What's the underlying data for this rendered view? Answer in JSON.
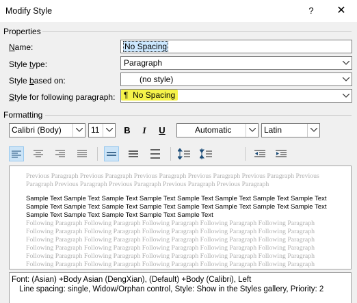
{
  "window": {
    "title": "Modify Style",
    "help_glyph": "?",
    "close_glyph": "✕"
  },
  "properties": {
    "section_label": "Properties",
    "name_label_pre": "",
    "name_label_u": "N",
    "name_label_post": "ame:",
    "name_value": "No Spacing",
    "type_label_pre": "Style ",
    "type_label_u": "t",
    "type_label_post": "ype:",
    "type_value": "Paragraph",
    "based_label_pre": "Style ",
    "based_label_u": "b",
    "based_label_post": "ased on:",
    "based_value": "(no style)",
    "following_label_pre": "",
    "following_label_u": "S",
    "following_label_post": "tyle for following paragraph:",
    "following_value": "No Spacing",
    "following_mark": "¶"
  },
  "formatting": {
    "section_label": "Formatting",
    "font": "Calibri (Body)",
    "size": "11",
    "bold": "B",
    "italic": "I",
    "underline": "U",
    "color": "Automatic",
    "script": "Latin",
    "highlight_color": "#f6f34a"
  },
  "preview": {
    "previous_lines": [
      "Previous Paragraph Previous Paragraph Previous Paragraph Previous Paragraph Previous Paragraph Previous",
      "Paragraph Previous Paragraph Previous Paragraph Previous Paragraph Previous Paragraph"
    ],
    "sample_lines": [
      "Sample Text Sample Text Sample Text Sample Text Sample Text Sample Text Sample Text Sample Text",
      "Sample Text Sample Text Sample Text Sample Text Sample Text Sample Text Sample Text Sample Text",
      "Sample Text Sample Text Sample Text Sample Text Sample Text"
    ],
    "following_lines": [
      "Following Paragraph Following Paragraph Following Paragraph Following Paragraph Following Paragraph",
      "Following Paragraph Following Paragraph Following Paragraph Following Paragraph Following Paragraph",
      "Following Paragraph Following Paragraph Following Paragraph Following Paragraph Following Paragraph",
      "Following Paragraph Following Paragraph Following Paragraph Following Paragraph Following Paragraph",
      "Following Paragraph Following Paragraph Following Paragraph Following Paragraph Following Paragraph",
      "Following Paragraph Following Paragraph Following Paragraph Following Paragraph Following Paragraph"
    ]
  },
  "description": {
    "line1": "Font: (Asian) +Body Asian (DengXian), (Default) +Body (Calibri), Left",
    "line2": "Line spacing:  single, Widow/Orphan control, Style: Show in the Styles gallery, Priority: 2"
  }
}
